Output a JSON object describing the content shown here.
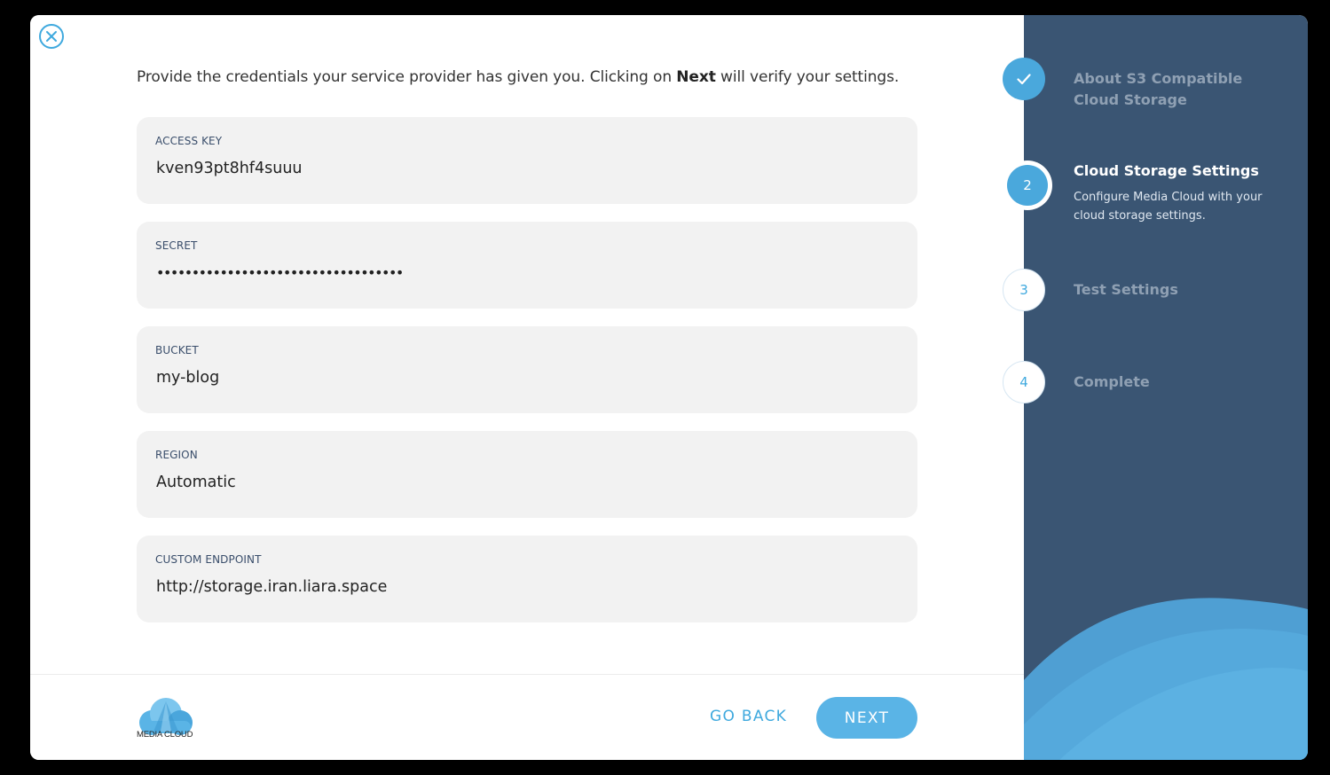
{
  "intro": {
    "before": "Provide the credentials your service provider has given you. Clicking on ",
    "bold": "Next",
    "after": " will verify your settings."
  },
  "fields": [
    {
      "label": "ACCESS KEY",
      "value": "kven93pt8hf4suuu"
    },
    {
      "label": "SECRET",
      "value": "•••••••••••••••••••••••••••••••••••"
    },
    {
      "label": "BUCKET",
      "value": "my-blog"
    },
    {
      "label": "REGION",
      "value": "Automatic"
    },
    {
      "label": "CUSTOM ENDPOINT",
      "value": "http://storage.iran.liara.space"
    }
  ],
  "footer": {
    "logo_text": "MEDIA CLOUD",
    "go_back": "GO BACK",
    "next": "NEXT"
  },
  "steps": [
    {
      "number": "",
      "status": "complete",
      "title": "About S3 Compatible Cloud Storage",
      "description": ""
    },
    {
      "number": "2",
      "status": "active",
      "title": "Cloud Storage Settings",
      "description": "Configure Media Cloud with your cloud storage settings."
    },
    {
      "number": "3",
      "status": "pending",
      "title": "Test Settings",
      "description": ""
    },
    {
      "number": "4",
      "status": "pending",
      "title": "Complete",
      "description": ""
    }
  ],
  "colors": {
    "accent": "#3fa9de",
    "button": "#5ab4e6",
    "sidebar": "#3a5573",
    "field_bg": "#f2f2f2"
  },
  "icons": {
    "close": "close-circle-icon",
    "check": "check-icon",
    "logo": "cloud-logo-icon"
  }
}
